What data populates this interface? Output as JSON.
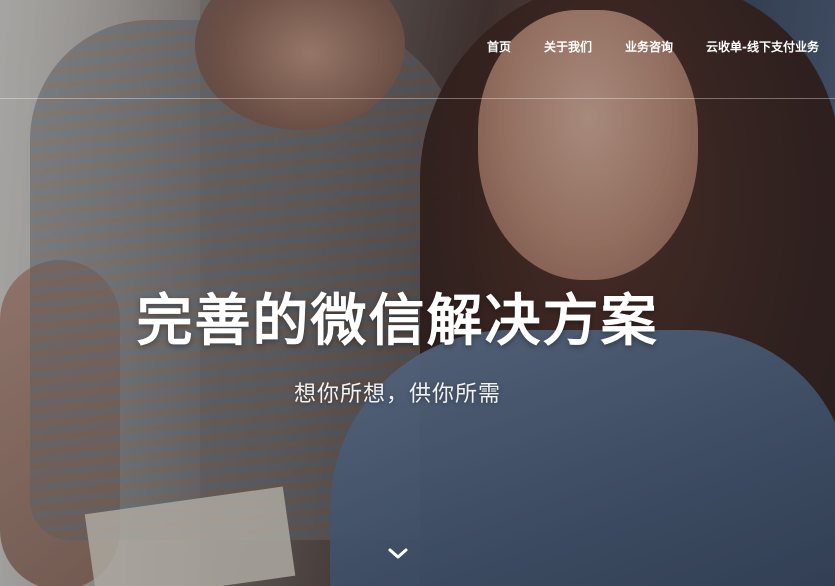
{
  "nav": {
    "items": [
      {
        "label": "首页"
      },
      {
        "label": "关于我们"
      },
      {
        "label": "业务咨询"
      },
      {
        "label": "云收单-线下支付业务"
      }
    ]
  },
  "hero": {
    "title": "完善的微信解决方案",
    "subtitle": "想你所想，供你所需",
    "scroll_icon": "chevron-down-icon",
    "text_color": "#ffffff"
  }
}
